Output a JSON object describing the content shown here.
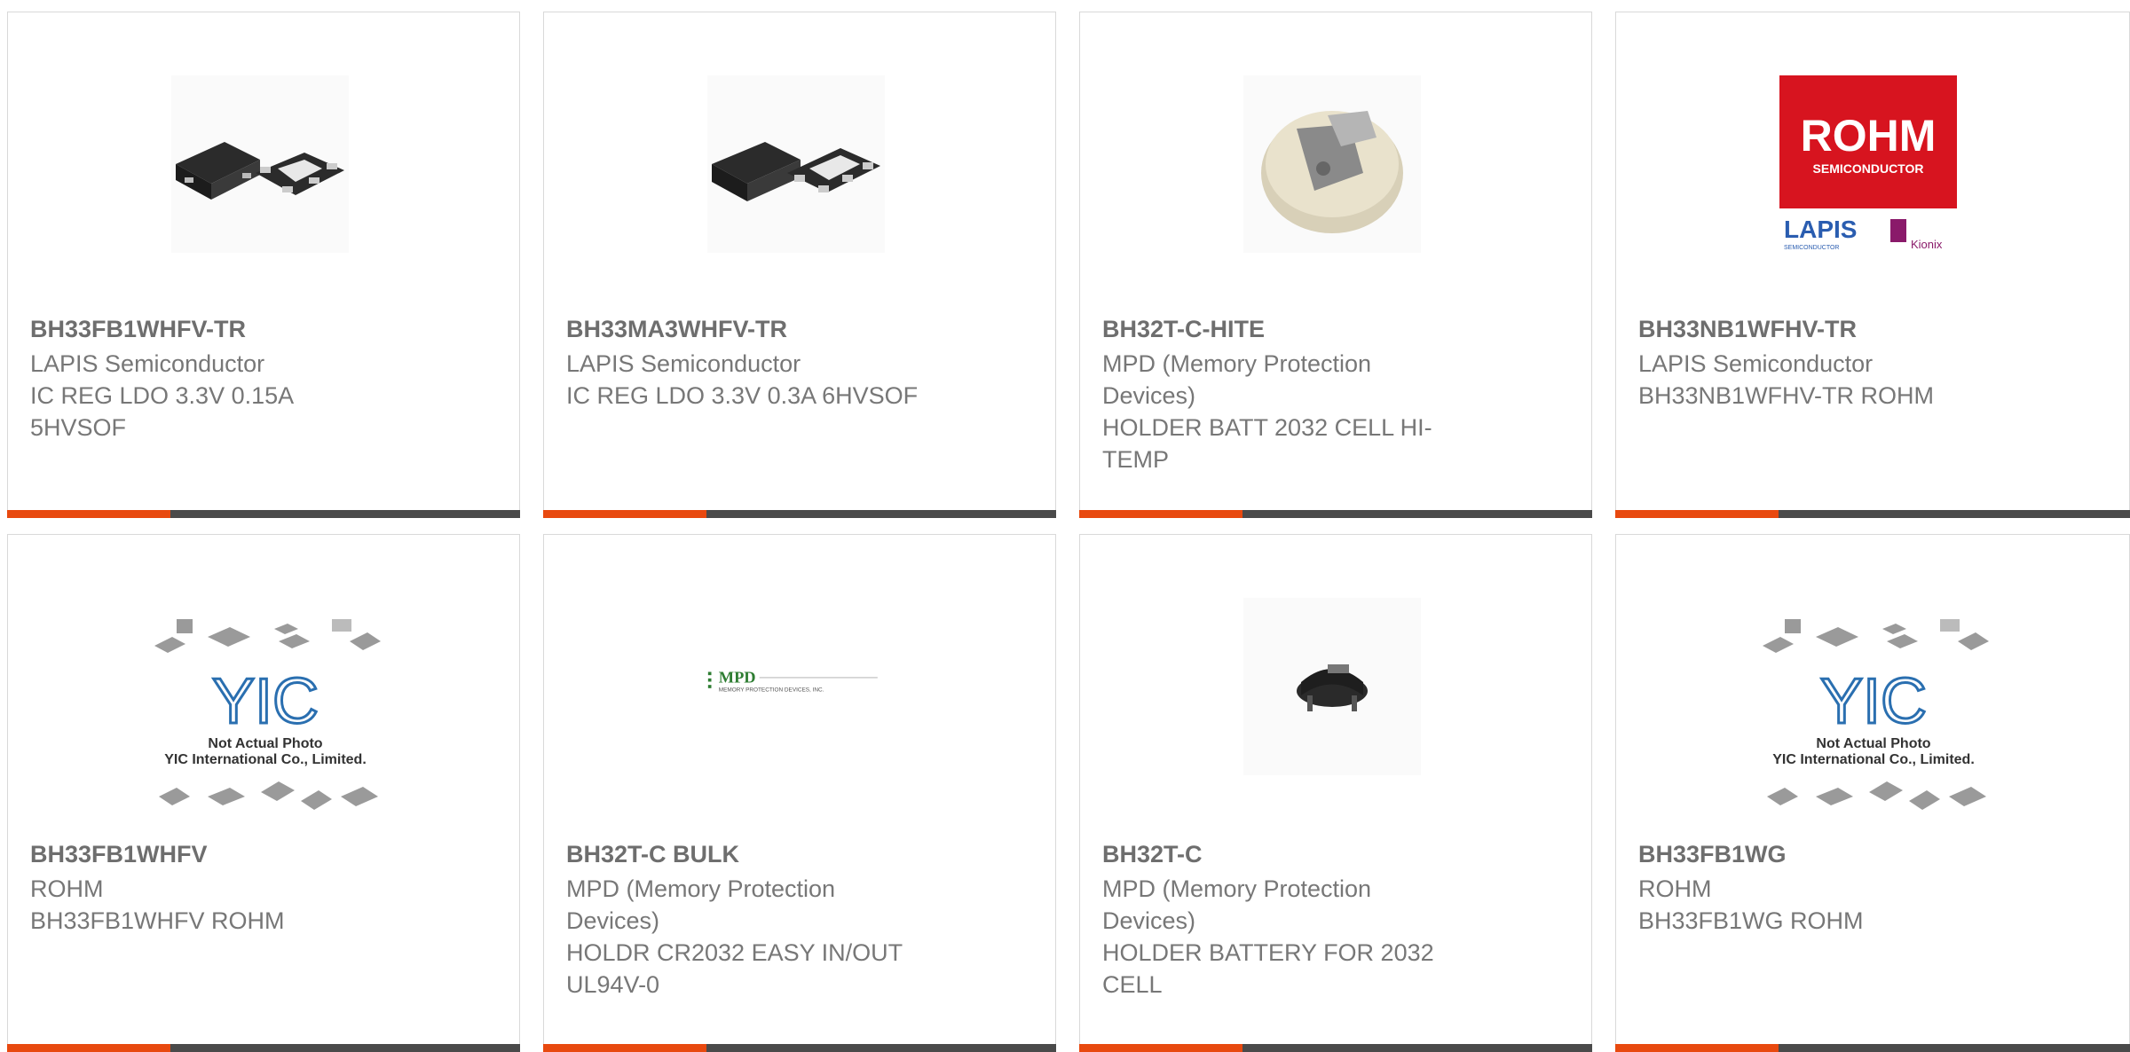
{
  "products": [
    {
      "part_number": "BH33FB1WHFV-TR",
      "manufacturer": "LAPIS Semiconductor",
      "description": "IC REG LDO 3.3V 0.15A 5HVSOF",
      "image": "ic-5pin-package-photo"
    },
    {
      "part_number": "BH33MA3WHFV-TR",
      "manufacturer": "LAPIS Semiconductor",
      "description": "IC REG LDO 3.3V 0.3A 6HVSOF",
      "image": "ic-6pin-package-photo"
    },
    {
      "part_number": "BH32T-C-HITE",
      "manufacturer": "MPD (Memory Protection Devices)",
      "description": "HOLDER BATT 2032 CELL HI-TEMP",
      "image": "battery-holder-beige-photo"
    },
    {
      "part_number": "BH33NB1WFHV-TR",
      "manufacturer": "LAPIS Semiconductor",
      "description": "BH33NB1WFHV-TR ROHM",
      "image": "rohm-lapis-kionix-logo"
    },
    {
      "part_number": "BH33FB1WHFV",
      "manufacturer": "ROHM",
      "description": "BH33FB1WHFV ROHM",
      "image": "yic-not-actual-photo"
    },
    {
      "part_number": "BH32T-C BULK",
      "manufacturer": "MPD (Memory Protection Devices)",
      "description": "HOLDR CR2032 EASY IN/OUT UL94V-0",
      "image": "mpd-logo"
    },
    {
      "part_number": "BH32T-C",
      "manufacturer": "MPD (Memory Protection Devices)",
      "description": "HOLDER BATTERY FOR 2032 CELL",
      "image": "battery-holder-black-photo"
    },
    {
      "part_number": "BH33FB1WG",
      "manufacturer": "ROHM",
      "description": "BH33FB1WG ROHM",
      "image": "yic-not-actual-photo"
    }
  ],
  "logos": {
    "rohm": {
      "brand": "ROHM",
      "sub": "SEMICONDUCTOR",
      "lapis": "LAPIS",
      "lapis_sub": "SEMICONDUCTOR",
      "kionix": "Kionix"
    },
    "mpd": {
      "brand": "MPD",
      "sub": "MEMORY PROTECTION DEVICES, INC."
    },
    "yic": {
      "brand": "YIC",
      "line1": "Not Actual Photo",
      "line2": "YIC International Co., Limited."
    }
  },
  "colors": {
    "accent": "#e8490f",
    "bar": "#4a4a4a",
    "rohm_red": "#d7141f",
    "mpd_green": "#2e7d32",
    "yic_blue": "#2a6fb0"
  }
}
